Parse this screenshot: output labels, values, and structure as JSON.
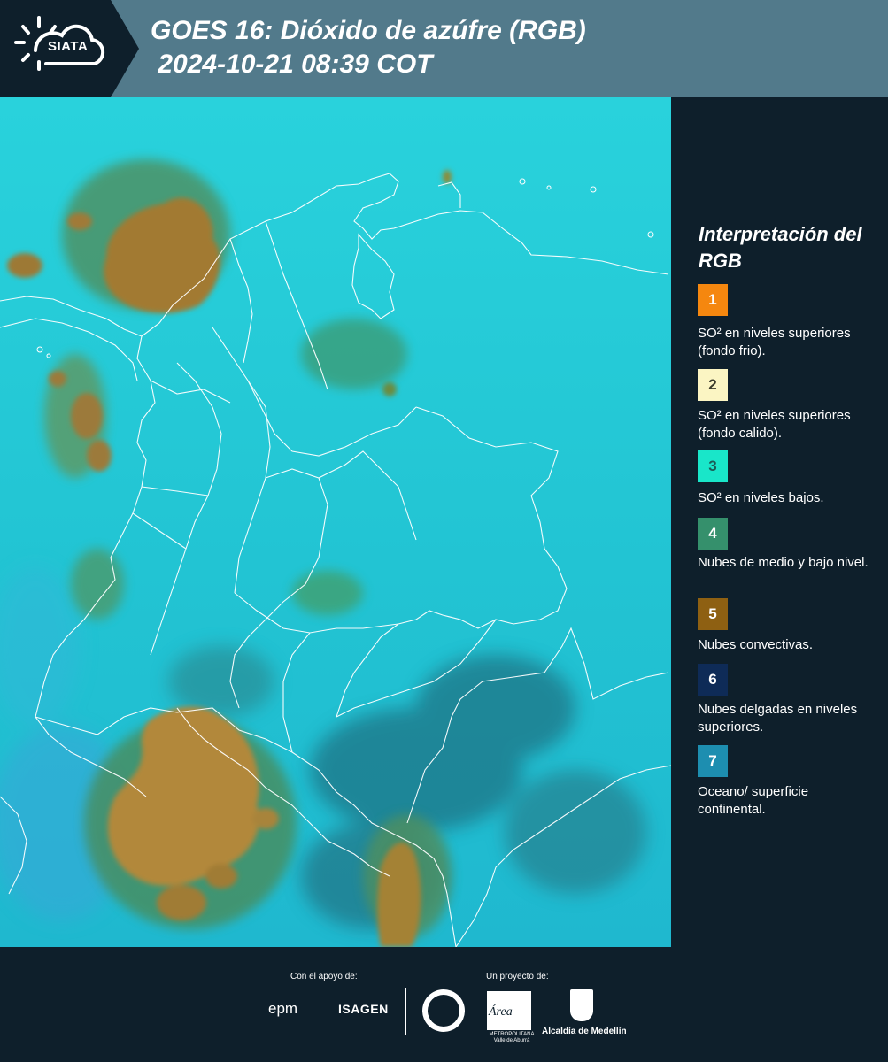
{
  "header": {
    "logo_text": "SIATA",
    "title_line1": "GOES 16: Dióxido de azúfre (RGB)",
    "title_line2": " 2024-10-21 08:39 COT"
  },
  "legend": {
    "title": "Interpretación del RGB",
    "items": [
      {
        "number": "1",
        "color": "#f5870f",
        "number_color": "#ffffff",
        "text": "SO² en niveles superiores (fondo frio)."
      },
      {
        "number": "2",
        "color": "#fbf5c3",
        "number_color": "#3a3a2a",
        "text": "SO² en niveles superiores (fondo calido)."
      },
      {
        "number": "3",
        "color": "#19e6c9",
        "number_color": "#1c5b55",
        "text": "SO² en niveles bajos."
      },
      {
        "number": "4",
        "color": "#35906c",
        "number_color": "#ffffff",
        "text": "Nubes de medio y bajo nivel."
      },
      {
        "number": "5",
        "color": "#8e6012",
        "number_color": "#ffffff",
        "text": "Nubes convectivas."
      },
      {
        "number": "6",
        "color": "#0e2b57",
        "number_color": "#ffffff",
        "text": "Nubes delgadas en niveles superiores."
      },
      {
        "number": "7",
        "color": "#1d8eb0",
        "number_color": "#ffffff",
        "text": "Oceano/ superficie continental."
      }
    ]
  },
  "footer": {
    "support_label": "Con el apoyo de:",
    "project_label": "Un proyecto de:",
    "sponsor1": "epm",
    "sponsor2": "ISAGEN",
    "partner_area": "Área",
    "partner_area_caption": "METROPOLITANA Valle de Aburrá",
    "partner_alcaldia": "Alcaldía de Medellín"
  },
  "colors": {
    "background": "#0e1f2b",
    "header": "#527a8b",
    "map_base": "#22c6d4",
    "convective": "#a87c2a",
    "midlevel": "#3f8f68"
  }
}
